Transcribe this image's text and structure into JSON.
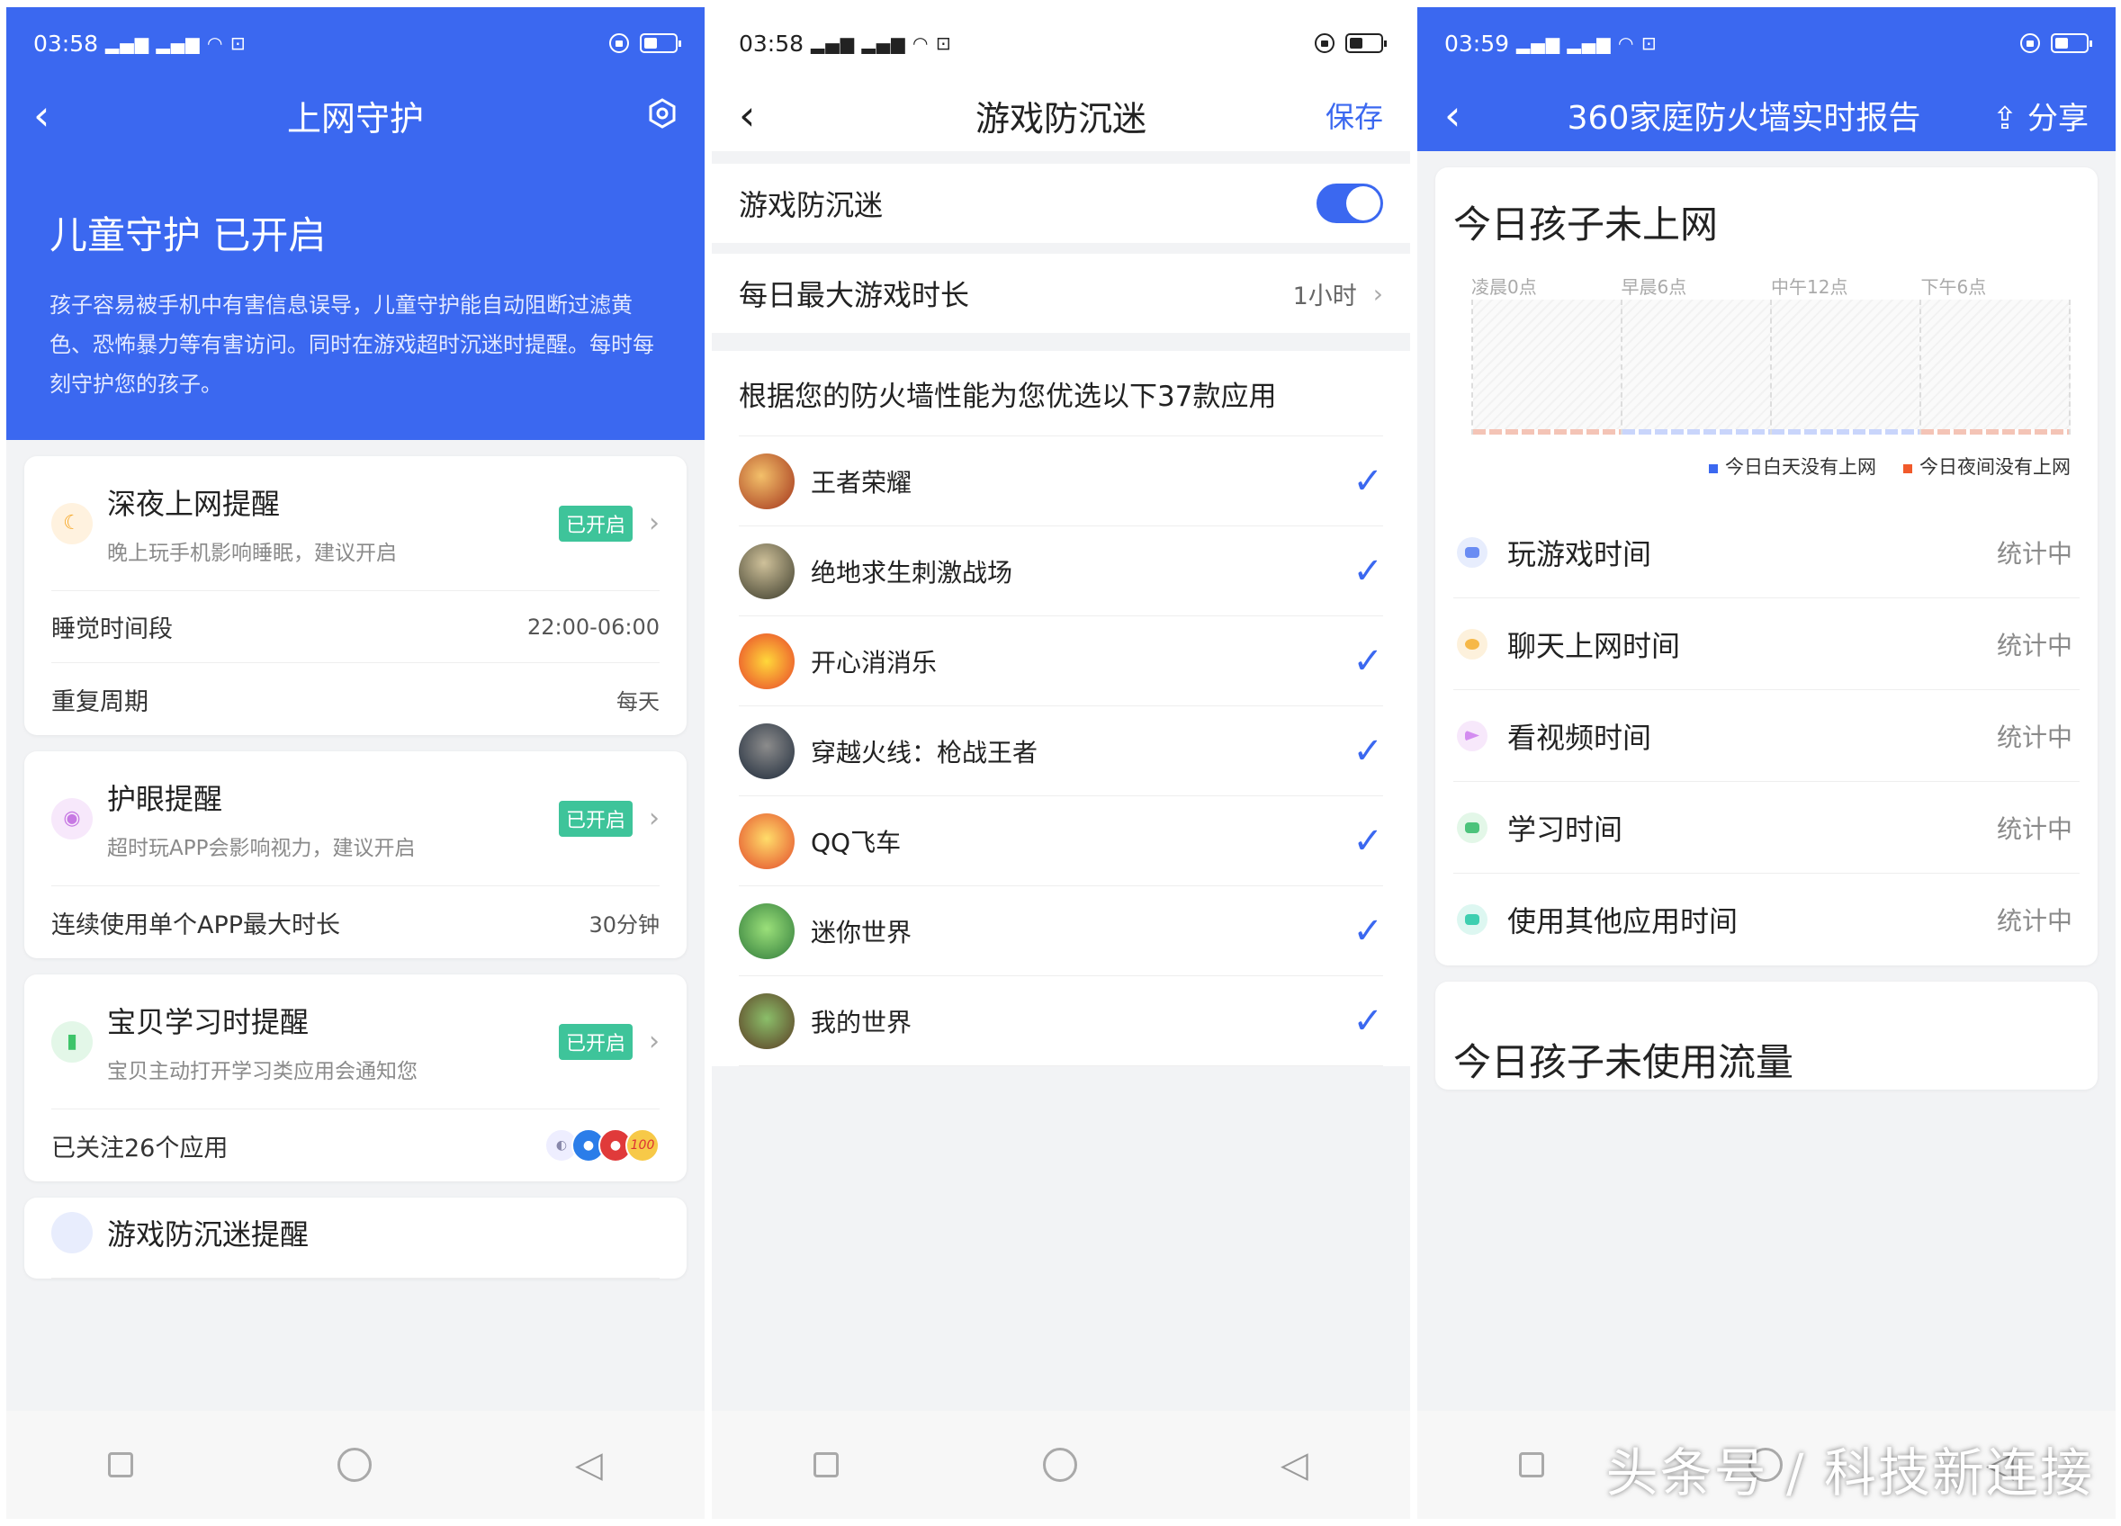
{
  "colors": {
    "accent": "#3b68f0",
    "badge": "#3ec49a",
    "night_legend": "#f15a2b",
    "day_legend": "#3b68f0"
  },
  "phone1": {
    "status_time": "03:58",
    "title": "上网守护",
    "hero_title": "儿童守护 已开启",
    "hero_desc": "孩子容易被手机中有害信息误导，儿童守护能自动阻断过滤黄色、恐怖暴力等有害访问。同时在游戏超时沉迷时提醒。每时每刻守护您的孩子。",
    "cards": [
      {
        "title": "深夜上网提醒",
        "subtitle": "晚上玩手机影响睡眠，建议开启",
        "badge": "已开启",
        "icon": "moon-icon",
        "rows": [
          {
            "label": "睡觉时间段",
            "value": "22:00-06:00"
          },
          {
            "label": "重复周期",
            "value": "每天"
          }
        ]
      },
      {
        "title": "护眼提醒",
        "subtitle": "超时玩APP会影响视力，建议开启",
        "badge": "已开启",
        "icon": "eye-icon",
        "rows": [
          {
            "label": "连续使用单个APP最大时长",
            "value": "30分钟"
          }
        ]
      },
      {
        "title": "宝贝学习时提醒",
        "subtitle": "宝贝主动打开学习类应用会通知您",
        "badge": "已开启",
        "icon": "book-icon",
        "rows": [
          {
            "label": "已关注26个应用",
            "value": ""
          }
        ]
      },
      {
        "title": "游戏防沉迷提醒"
      }
    ],
    "app_logo_text": "100"
  },
  "phone2": {
    "status_time": "03:58",
    "title": "游戏防沉迷",
    "save": "保存",
    "toggle_label": "游戏防沉迷",
    "max_time_label": "每日最大游戏时长",
    "max_time_value": "1小时",
    "list_header": "根据您的防火墙性能为您优选以下37款应用",
    "apps": [
      "王者荣耀",
      "绝地求生刺激战场",
      "开心消消乐",
      "穿越火线：枪战王者",
      "QQ飞车",
      "迷你世界",
      "我的世界"
    ]
  },
  "phone3": {
    "status_time": "03:59",
    "title": "360家庭防火墙实时报告",
    "share": "分享",
    "card_title": "今日孩子未上网",
    "time_slots": [
      "凌晨0点",
      "早晨6点",
      "中午12点",
      "下午6点"
    ],
    "legend_day": "今日白天没有上网",
    "legend_night": "今日夜间没有上网",
    "stats": [
      {
        "label": "玩游戏时间",
        "value": "统计中",
        "color": "#6a8cf3"
      },
      {
        "label": "聊天上网时间",
        "value": "统计中",
        "color": "#f6b848"
      },
      {
        "label": "看视频时间",
        "value": "统计中",
        "color": "#d38cf0"
      },
      {
        "label": "学习时间",
        "value": "统计中",
        "color": "#4cc37b"
      },
      {
        "label": "使用其他应用时间",
        "value": "统计中",
        "color": "#3ecfb0"
      }
    ],
    "next_card_title": "今日孩子未使用流量",
    "watermark": "头条号 / 科技新连接"
  }
}
